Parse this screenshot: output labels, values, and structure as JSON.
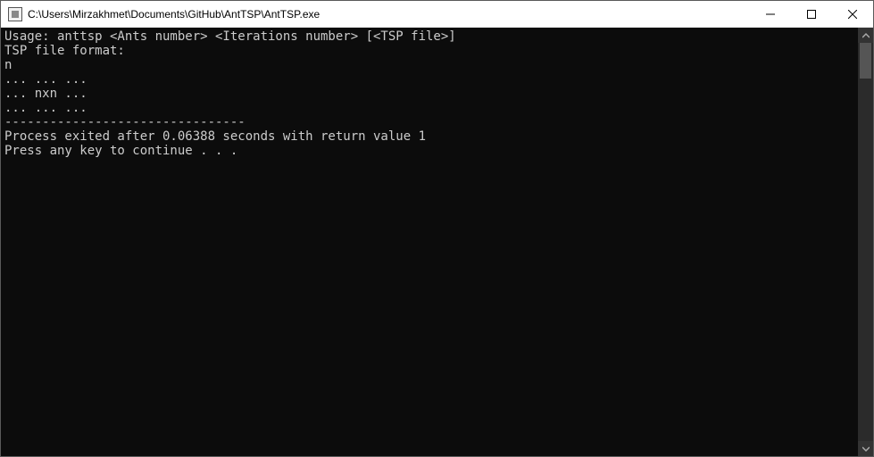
{
  "window": {
    "title": "C:\\Users\\Mirzakhmet\\Documents\\GitHub\\AntTSP\\AntTSP.exe"
  },
  "console": {
    "lines": [
      "Usage: anttsp <Ants number> <Iterations number> [<TSP file>]",
      "TSP file format:",
      "n",
      "... ... ...",
      "... nxn ...",
      "... ... ...",
      "--------------------------------",
      "Process exited after 0.06388 seconds with return value 1",
      "Press any key to continue . . ."
    ]
  }
}
